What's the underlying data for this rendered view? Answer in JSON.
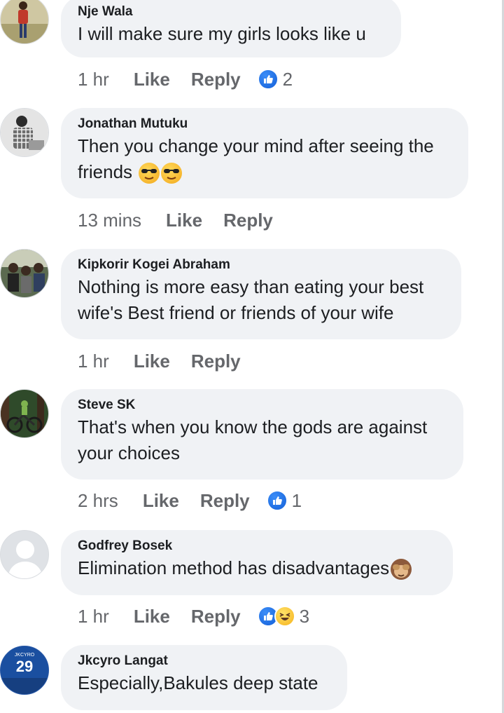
{
  "comments": [
    {
      "author": "Nje Wala",
      "text": "I will make sure my girls looks like u",
      "time": "1 hr",
      "like_label": "Like",
      "reply_label": "Reply",
      "reaction_count": "2",
      "reaction_icons": [
        "like-icon"
      ]
    },
    {
      "author": "Jonathan Mutuku",
      "text": "Then you change your mind after seeing the friends",
      "emojis": [
        "sunglasses-face-emoji",
        "sunglasses-face-emoji"
      ],
      "time": "13 mins",
      "like_label": "Like",
      "reply_label": "Reply"
    },
    {
      "author": "Kipkorir Kogei Abraham",
      "text": "Nothing is more easy than eating your best wife's Best friend or friends of your wife",
      "time": "1 hr",
      "like_label": "Like",
      "reply_label": "Reply"
    },
    {
      "author": "Steve SK",
      "text": "That's when you know the gods are against your choices",
      "time": "2 hrs",
      "like_label": "Like",
      "reply_label": "Reply",
      "reaction_count": "1",
      "reaction_icons": [
        "like-icon"
      ]
    },
    {
      "author": "Godfrey Bosek",
      "text": "Elimination method has disadvantages",
      "emojis": [
        "see-no-evil-monkey-emoji"
      ],
      "time": "1 hr",
      "like_label": "Like",
      "reply_label": "Reply",
      "reaction_count": "3",
      "reaction_icons": [
        "like-icon",
        "haha-icon"
      ]
    },
    {
      "author": "Jkcyro Langat",
      "text": "Especially,Bakules deep state",
      "avatar_jersey_number": "29",
      "avatar_jersey_name": "JKCYRO"
    }
  ],
  "colors": {
    "bubble": "#f0f2f5",
    "meta_text": "#65676b",
    "like_blue": "#1877f2",
    "jersey_blue": "#1a4fa0"
  }
}
